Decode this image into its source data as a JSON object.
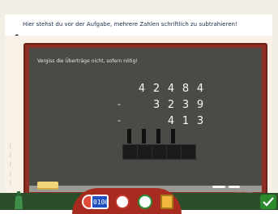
{
  "instruction": "Hier stehst du vor der Aufgabe, mehrere Zahlen schriftlich zu subtrahieren!",
  "board_note": "Vergiss die Überträge nicht, sofern nötig!",
  "problem": {
    "minuend": [
      "4",
      "2",
      "4",
      "8",
      "4"
    ],
    "subtrahend_1": [
      "3",
      "2",
      "3",
      "9"
    ],
    "subtrahend_2": [
      "4",
      "1",
      "3"
    ],
    "minus": "-"
  },
  "toolbar": {
    "timer_label": "0100"
  },
  "signature": "Rt. Kal"
}
